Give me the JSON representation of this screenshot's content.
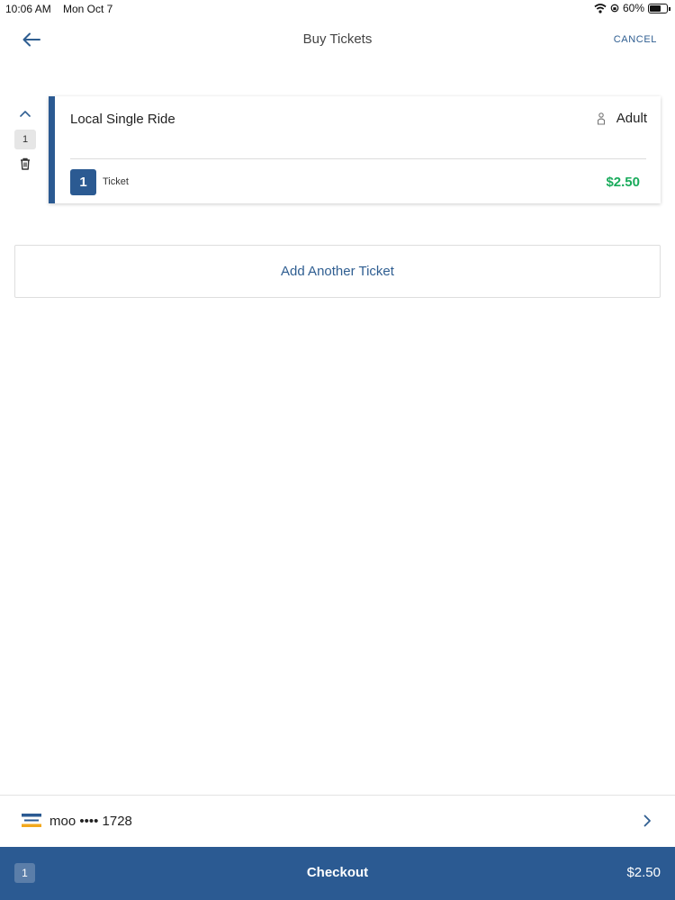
{
  "status_bar": {
    "time": "10:06 AM",
    "date": "Mon Oct 7",
    "battery": "60%"
  },
  "nav": {
    "title": "Buy Tickets",
    "cancel_label": "CANCEL",
    "back_icon": "arrow-left-icon"
  },
  "ticket_group": {
    "quantity": "1"
  },
  "ticket": {
    "title": "Local Single Ride",
    "rider_type": "Adult",
    "count": "1",
    "count_label": "Ticket",
    "price": "$2.50"
  },
  "add_ticket_label": "Add Another Ticket",
  "payment": {
    "label": "moo •••• 1728",
    "icon": "credit-card-icon"
  },
  "checkout": {
    "count": "1",
    "label": "Checkout",
    "total": "$2.50"
  },
  "colors": {
    "primary": "#2b5a92",
    "link": "#2f5e91",
    "price": "#1aab5c"
  }
}
